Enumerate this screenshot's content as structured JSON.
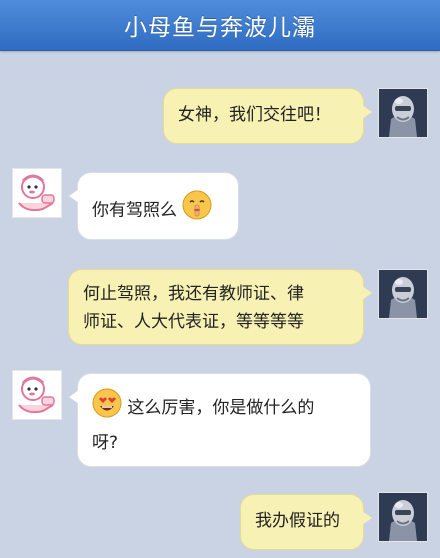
{
  "header": {
    "title": "小母鱼与奔波儿灞"
  },
  "messages": [
    {
      "side": "right",
      "sender": "me",
      "text": "女神，我们交往吧！"
    },
    {
      "side": "left",
      "sender": "girl",
      "text": "你有驾照么",
      "emoji": "shush-face-icon"
    },
    {
      "side": "right",
      "sender": "me",
      "line1": "何止驾照，我还有教师证、律",
      "line2": "师证、人大代表证，等等等等"
    },
    {
      "side": "left",
      "sender": "girl",
      "emoji": "heart-eyes-icon",
      "line1": "这么厉害，你是做什么的",
      "line2": "呀?"
    },
    {
      "side": "right",
      "sender": "me",
      "text": "我办假证的"
    }
  ],
  "colors": {
    "background": "#c9d3e3",
    "header": "#3a78cc",
    "bubble_right": "#f7f1b4",
    "bubble_left": "#ffffff"
  }
}
